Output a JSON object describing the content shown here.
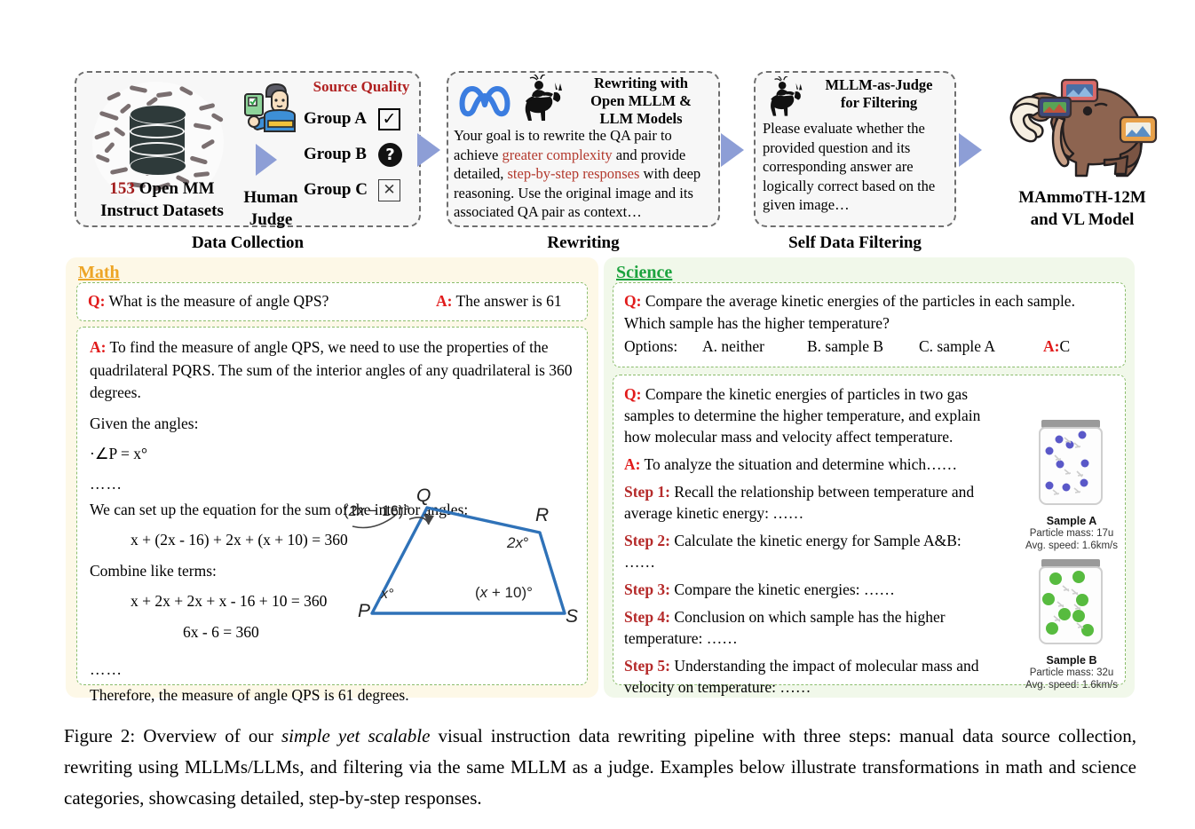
{
  "pipeline": {
    "collection": {
      "dataset_count": "153",
      "dataset_label": " Open MM",
      "dataset_label2": "Instruct Datasets",
      "judge_label_1": "Human",
      "judge_label_2": "Judge",
      "quality_title": "Source Quality",
      "groups": [
        {
          "label": "Group A",
          "mark": "✓",
          "mark_kind": "check"
        },
        {
          "label": "Group B",
          "mark": "?",
          "mark_kind": "question"
        },
        {
          "label": "Group C",
          "mark": "✕",
          "mark_kind": "cross"
        }
      ],
      "caption": "Data Collection"
    },
    "rewriting": {
      "title_line1": "Rewriting with",
      "title_line2": "Open MLLM &",
      "title_line3": "LLM Models",
      "prompt_part1": "Your goal is to rewrite the QA pair to achieve ",
      "prompt_hl1": "greater complexity",
      "prompt_part2": " and provide detailed, ",
      "prompt_hl2": "step-by-step responses",
      "prompt_part3": " with deep reasoning. Use the original image and its associated QA pair as context…",
      "caption": "Rewriting"
    },
    "filtering": {
      "title_line1": "MLLM-as-Judge",
      "title_line2": "for Filtering",
      "prompt": "Please evaluate whether the provided question and its corresponding answer are logically correct based on the given image…",
      "caption": "Self Data Filtering"
    },
    "model": {
      "label_line1": "MAmmoTH-12M",
      "label_line2": "and VL Model"
    }
  },
  "math_panel": {
    "title": "Math",
    "original": {
      "q_label": "Q:",
      "q_text": " What is the measure of angle QPS?",
      "a_label": "A:",
      "a_text": " The answer is 61"
    },
    "rewritten": {
      "a_label": "A:",
      "intro": " To find the measure of angle QPS, we need to use the properties of the quadrilateral PQRS. The sum of the interior angles of any quadrilateral is 360 degrees.",
      "given": "Given the angles:",
      "angle_p": "·∠P = x°",
      "dots1": "……",
      "setup": "We can set up the equation for the sum of the interior angles:",
      "eq1": "x + (2x - 16) + 2x + (x + 10) = 360",
      "combine": "Combine like terms:",
      "eq2": "x + 2x + 2x + x - 16 + 10 = 360",
      "eq3": "6x - 6 = 360",
      "dots2": "……",
      "conclusion": "Therefore, the measure of angle QPS is 61 degrees."
    },
    "diagram": {
      "vertex_p": "P",
      "vertex_q": "Q",
      "vertex_r": "R",
      "vertex_s": "S",
      "angle_p": "x°",
      "angle_q": "(2x − 16)°",
      "angle_r": "2x°",
      "angle_s": "(x + 10)°",
      "stroke_color": "#2f72b8"
    }
  },
  "science_panel": {
    "title": "Science",
    "original": {
      "q_label": "Q:",
      "q_text": " Compare the average kinetic energies of the particles in each sample. Which sample has the higher temperature?",
      "options_prefix": "Options:",
      "option_a": "A. neither",
      "option_b": "B. sample B",
      "option_c": "C. sample A",
      "a_label": "A:",
      "a_text": " C"
    },
    "rewritten": {
      "q_label": "Q:",
      "q_text": " Compare the kinetic energies of particles in two gas samples to determine the higher temperature, and explain how molecular mass and velocity affect temperature.",
      "a_label": "A:",
      "a_text": " To analyze the situation and determine which……",
      "steps": [
        {
          "label": "Step 1:",
          "text": " Recall the relationship between temperature and average kinetic energy: ……"
        },
        {
          "label": "Step 2:",
          "text": " Calculate the kinetic energy for Sample A&B: ……"
        },
        {
          "label": "Step 3:",
          "text": " Compare the kinetic energies: ……"
        },
        {
          "label": "Step 4:",
          "text": " Conclusion on which sample has the higher temperature: ……"
        },
        {
          "label": "Step 5:",
          "text": " Understanding the impact of molecular mass and velocity on temperature: ……"
        }
      ]
    },
    "jars": [
      {
        "name": "Sample A",
        "mass": "Particle mass: 17u",
        "speed": "Avg. speed: 1.6km/s",
        "particle_color": "#5a58c8"
      },
      {
        "name": "Sample B",
        "mass": "Particle mass: 32u",
        "speed": "Avg. speed: 1.6km/s",
        "particle_color": "#57bb3f"
      }
    ]
  },
  "figure_caption": {
    "prefix": "Figure 2: Overview of our ",
    "italic": "simple yet scalable",
    "rest": " visual instruction data rewriting pipeline with three steps: manual data source collection, rewriting using MLLMs/LLMs, and filtering via the same MLLM as a judge. Examples below illustrate transformations in math and science categories, showcasing detailed, step-by-step responses."
  },
  "colors": {
    "accent_red": "#b02020",
    "math_title": "#eda526",
    "science_title": "#1da33f",
    "arrow": "#8d9ed6",
    "math_bg": "#fdf8e7",
    "science_bg": "#f1f8ea"
  }
}
